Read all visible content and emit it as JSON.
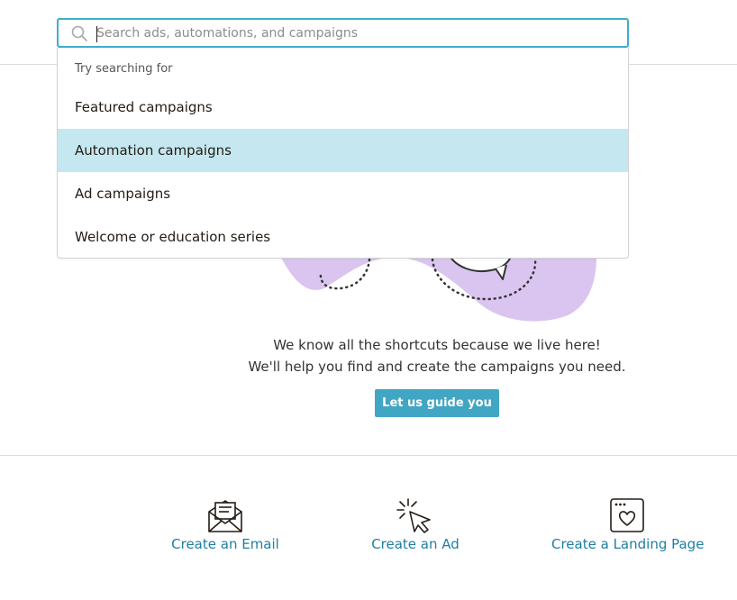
{
  "search": {
    "placeholder": "Search ads, automations, and campaigns",
    "value": ""
  },
  "dropdown": {
    "heading": "Try searching for",
    "items": [
      {
        "label": "Featured campaigns",
        "highlighted": false
      },
      {
        "label": "Automation campaigns",
        "highlighted": true
      },
      {
        "label": "Ad campaigns",
        "highlighted": false
      },
      {
        "label": "Welcome or education series",
        "highlighted": false
      }
    ]
  },
  "help": {
    "line1": "We know all the shortcuts because we live here!",
    "line2": "We'll help you find and create the campaigns you need.",
    "button_label": "Let us guide you"
  },
  "actions": [
    {
      "label": "Create an Email",
      "icon": "envelope-icon"
    },
    {
      "label": "Create an Ad",
      "icon": "cursor-click-icon"
    },
    {
      "label": "Create a Landing Page",
      "icon": "heart-page-icon"
    }
  ],
  "colors": {
    "accent": "#3eaecb",
    "highlight": "#c5e8f0",
    "button": "#41a6c4",
    "link": "#1e7fa3",
    "illustration": "#d9c5ef"
  }
}
